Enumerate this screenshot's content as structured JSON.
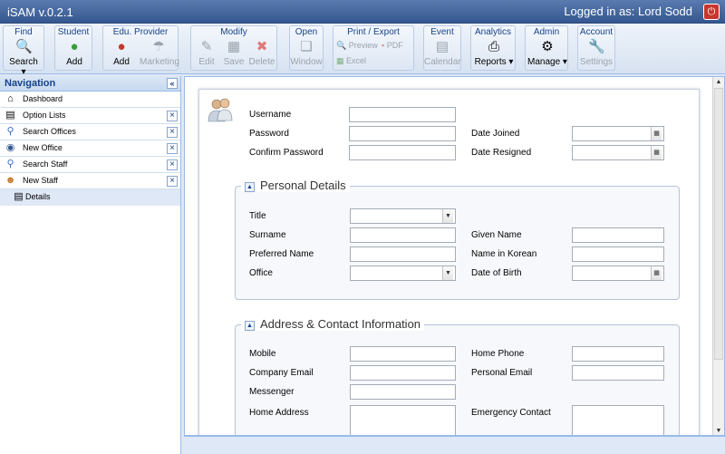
{
  "app": {
    "title": "iSAM v.0.2.1",
    "logged_in": "Logged in as: Lord Sodd"
  },
  "toolbar": {
    "find": {
      "label": "Find",
      "search": "Search"
    },
    "student": {
      "label": "Student",
      "add": "Add"
    },
    "provider": {
      "label": "Edu. Provider",
      "add": "Add",
      "marketing": "Marketing"
    },
    "modify": {
      "label": "Modify",
      "edit": "Edit",
      "save": "Save",
      "delete": "Delete"
    },
    "open": {
      "label": "Open",
      "window": "Window"
    },
    "print": {
      "label": "Print / Export",
      "preview": "Preview",
      "pdf": "PDF",
      "excel": "Excel"
    },
    "event": {
      "label": "Event",
      "calendar": "Calendar"
    },
    "analytics": {
      "label": "Analytics",
      "reports": "Reports"
    },
    "admin": {
      "label": "Admin",
      "manage": "Manage"
    },
    "account": {
      "label": "Account",
      "settings": "Settings"
    }
  },
  "nav": {
    "title": "Navigation",
    "items": [
      {
        "label": "Dashboard",
        "icon": "home-icon"
      },
      {
        "label": "Option Lists",
        "icon": "list-icon"
      },
      {
        "label": "Search Offices",
        "icon": "search-icon"
      },
      {
        "label": "New Office",
        "icon": "office-icon"
      },
      {
        "label": "Search Staff",
        "icon": "search-icon"
      },
      {
        "label": "New Staff",
        "icon": "staff-icon"
      }
    ],
    "sub": {
      "label": "Details",
      "icon": "form-icon"
    }
  },
  "form": {
    "account": {
      "username": "Username",
      "password": "Password",
      "confirm": "Confirm Password",
      "date_joined": "Date Joined",
      "date_resigned": "Date Resigned"
    },
    "personal": {
      "title": "Personal Details",
      "title_field": "Title",
      "surname": "Surname",
      "preferred": "Preferred Name",
      "office": "Office",
      "given": "Given Name",
      "korean": "Name in Korean",
      "dob": "Date of Birth"
    },
    "contact": {
      "title": "Address & Contact Information",
      "mobile": "Mobile",
      "company_email": "Company Email",
      "messenger": "Messenger",
      "home_address": "Home Address",
      "home_phone": "Home Phone",
      "personal_email": "Personal Email",
      "emergency": "Emergency Contact"
    }
  }
}
